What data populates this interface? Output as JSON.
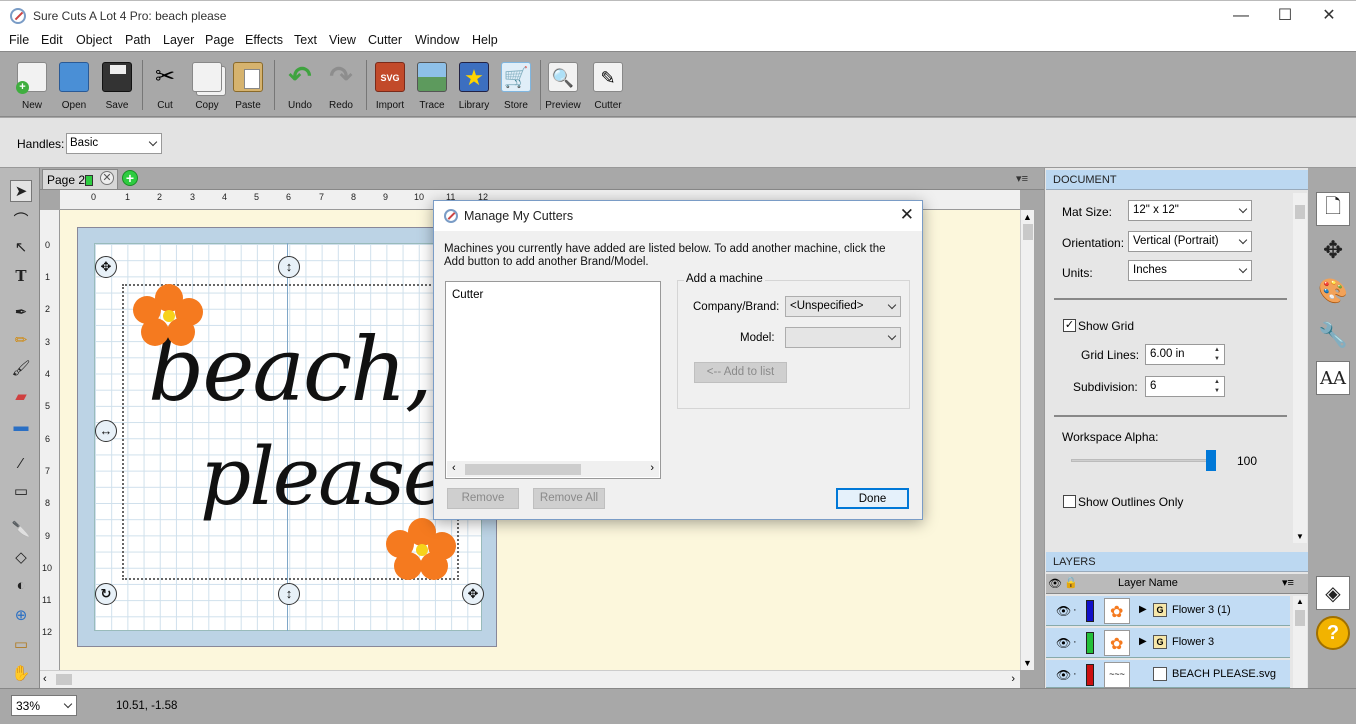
{
  "window": {
    "title": "Sure Cuts A Lot 4 Pro: beach please",
    "controls": {
      "minimize": "—",
      "maximize": "☐",
      "close": "✕"
    }
  },
  "menu": [
    "File",
    "Edit",
    "Object",
    "Path",
    "Layer",
    "Page",
    "Effects",
    "Text",
    "View",
    "Cutter",
    "Window",
    "Help"
  ],
  "toolbar": [
    {
      "label": "New",
      "icon": "new-document-icon",
      "color": "#f2f2f2"
    },
    {
      "label": "Open",
      "icon": "open-folder-icon",
      "color": "#4a8fd6"
    },
    {
      "label": "Save",
      "icon": "save-disk-icon",
      "color": "#333333"
    },
    {
      "label": "Cut",
      "icon": "scissors-icon",
      "color": "#d9d9d9"
    },
    {
      "label": "Copy",
      "icon": "copy-icon",
      "color": "#f2f2f2"
    },
    {
      "label": "Paste",
      "icon": "paste-clipboard-icon",
      "color": "#d6b36e"
    },
    {
      "label": "Undo",
      "icon": "undo-arrow-icon",
      "color": "#3fa33f"
    },
    {
      "label": "Redo",
      "icon": "redo-arrow-icon",
      "color": "#8d8d8d"
    },
    {
      "label": "Import",
      "icon": "import-svg-icon",
      "color": "#c24a2a"
    },
    {
      "label": "Trace",
      "icon": "trace-image-icon",
      "color": "#5d9a5d"
    },
    {
      "label": "Library",
      "icon": "library-star-icon",
      "color": "#3c6fc0"
    },
    {
      "label": "Store",
      "icon": "store-cart-icon",
      "color": "#7fb6e0"
    },
    {
      "label": "Preview",
      "icon": "preview-magnifier-icon",
      "color": "#f2f2f2"
    },
    {
      "label": "Cutter",
      "icon": "cutter-blade-icon",
      "color": "#f2f2f2"
    }
  ],
  "handles": {
    "label": "Handles:",
    "value": "Basic"
  },
  "page_tab": {
    "label": "Page 2",
    "add": "+",
    "close": "✕",
    "menu": "▾≡"
  },
  "ruler": {
    "h": [
      "0",
      "1",
      "2",
      "3",
      "4",
      "5",
      "6",
      "7",
      "8",
      "9",
      "10",
      "11",
      "12"
    ],
    "v": [
      "0",
      "1",
      "2",
      "3",
      "4",
      "5",
      "6",
      "7",
      "8",
      "9",
      "10",
      "11",
      "12"
    ]
  },
  "artwork": {
    "line1": "beach,",
    "line2": "please!"
  },
  "status": {
    "zoom": "33%",
    "coords": "10.51, -1.58"
  },
  "document_panel": {
    "header": "DOCUMENT",
    "mat_size": {
      "label": "Mat Size:",
      "value": "12\" x 12\""
    },
    "orientation": {
      "label": "Orientation:",
      "value": "Vertical (Portrait)"
    },
    "units": {
      "label": "Units:",
      "value": "Inches"
    },
    "show_grid": {
      "label": "Show Grid",
      "checked": true,
      "mark": "✓"
    },
    "grid_lines": {
      "label": "Grid Lines:",
      "value": "6.00 in"
    },
    "subdivision": {
      "label": "Subdivision:",
      "value": "6"
    },
    "workspace_alpha": {
      "label": "Workspace Alpha:",
      "value": "100"
    },
    "show_outlines": {
      "label": "Show Outlines Only",
      "checked": false
    }
  },
  "layers_panel": {
    "header": "LAYERS",
    "column": "Layer Name",
    "rows": [
      {
        "name": "Flower 3 (1)",
        "color": "#1010c8",
        "group": true
      },
      {
        "name": "Flower 3",
        "color": "#22c03a",
        "group": true
      },
      {
        "name": "BEACH PLEASE.svg",
        "color": "#cc1010",
        "group": false
      }
    ]
  },
  "dialog": {
    "title": "Manage My Cutters",
    "description": "Machines you currently have added are listed below. To add another machine, click the Add button to add another Brand/Model.",
    "list_items": [
      "Cutter"
    ],
    "add_group": "Add a machine",
    "company_label": "Company/Brand:",
    "company_value": "<Unspecified>",
    "model_label": "Model:",
    "model_value": "",
    "add_button": "<-- Add to list",
    "remove_button": "Remove",
    "remove_all_button": "Remove All",
    "done_button": "Done"
  },
  "colors": {
    "accent": "#0078d7",
    "panel_header": "#bcd8f1",
    "canvas": "#fcf7dc",
    "flower": "#f57a1f"
  }
}
